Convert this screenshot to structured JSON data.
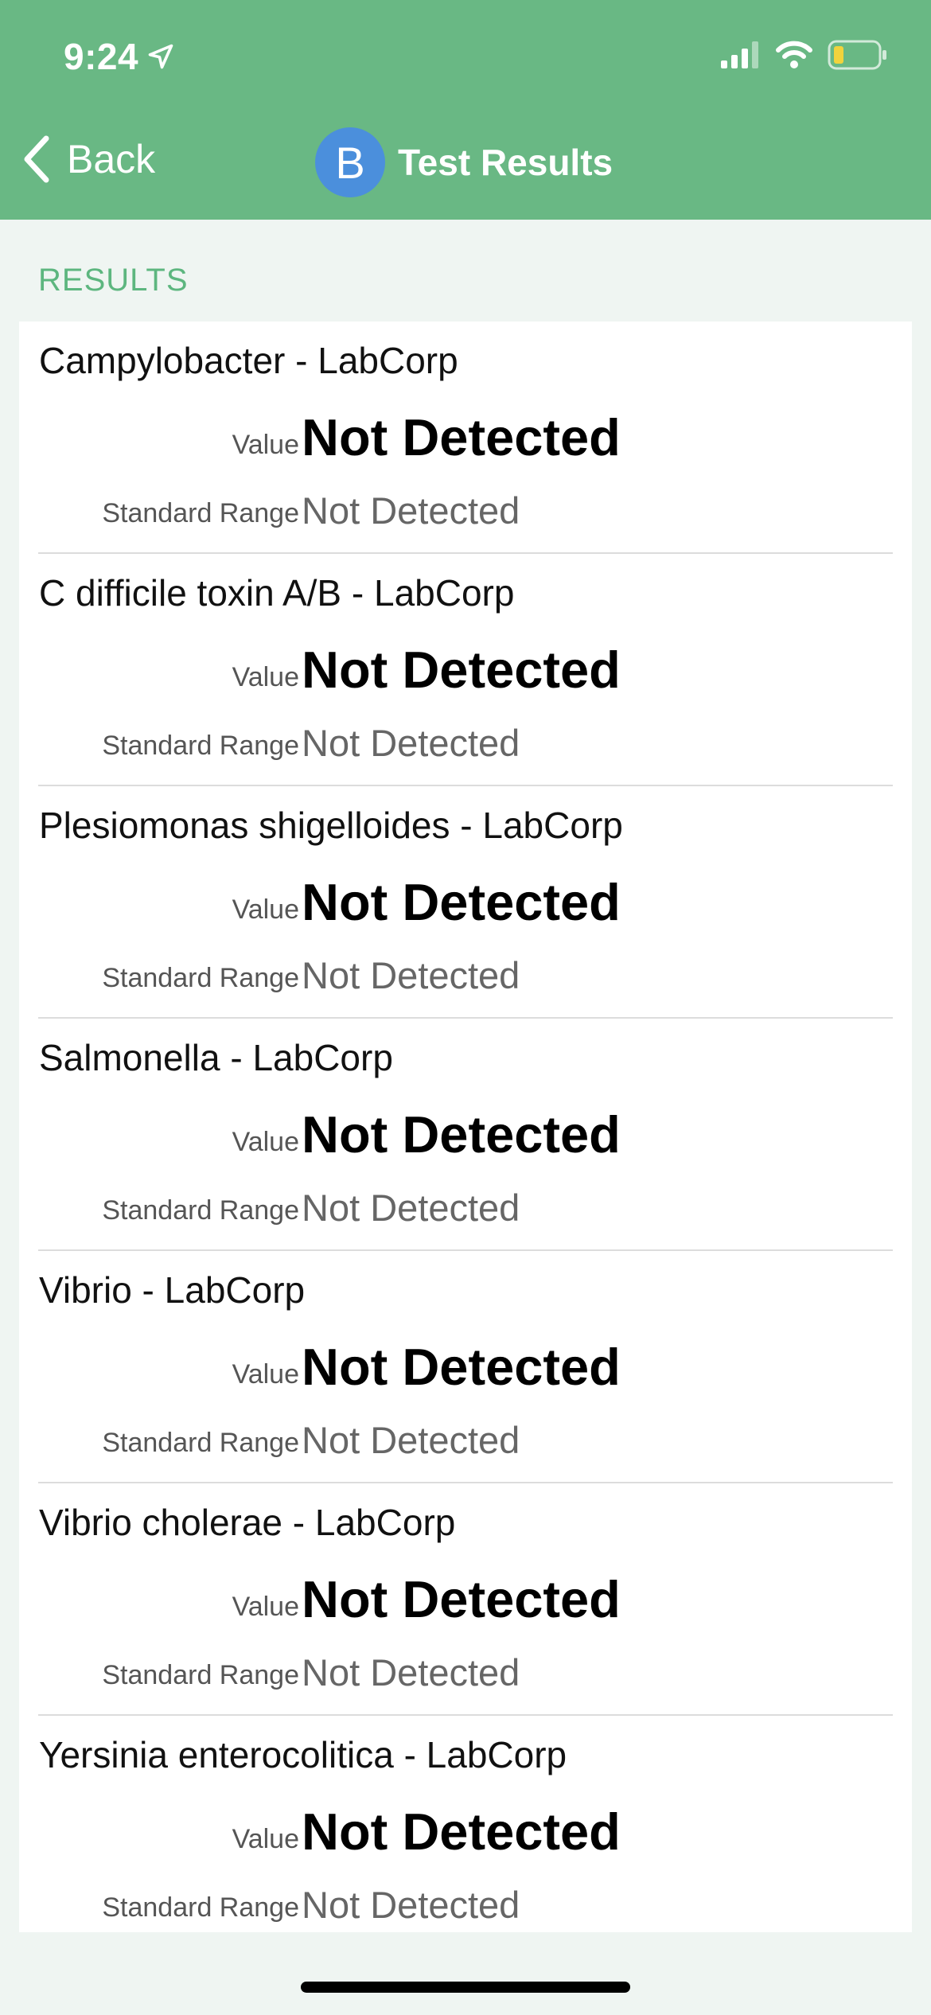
{
  "status_bar": {
    "time": "9:24"
  },
  "nav": {
    "back_label": "Back",
    "avatar_letter": "B",
    "title": "Test Results"
  },
  "section": {
    "header": "RESULTS"
  },
  "labels": {
    "value": "Value",
    "standard_range": "Standard Range"
  },
  "results": [
    {
      "name": "Campylobacter - LabCorp",
      "value": "Not Detected",
      "range": "Not Detected"
    },
    {
      "name": "C difficile toxin A/B - LabCorp",
      "value": "Not Detected",
      "range": "Not Detected"
    },
    {
      "name": "Plesiomonas shigelloides - LabCorp",
      "value": "Not Detected",
      "range": "Not Detected"
    },
    {
      "name": "Salmonella - LabCorp",
      "value": "Not Detected",
      "range": "Not Detected"
    },
    {
      "name": "Vibrio - LabCorp",
      "value": "Not Detected",
      "range": "Not Detected"
    },
    {
      "name": "Vibrio cholerae - LabCorp",
      "value": "Not Detected",
      "range": "Not Detected"
    },
    {
      "name": "Yersinia enterocolitica - LabCorp",
      "value": "Not Detected",
      "range": "Not Detected"
    }
  ],
  "colors": {
    "header_bg": "#69b884",
    "accent_text": "#5db67f",
    "avatar_bg": "#4b8fdc",
    "battery_level": "#f2d33c"
  },
  "icons": [
    "location-arrow-icon",
    "cellular-signal-icon",
    "wifi-icon",
    "battery-icon",
    "chevron-left-icon"
  ]
}
